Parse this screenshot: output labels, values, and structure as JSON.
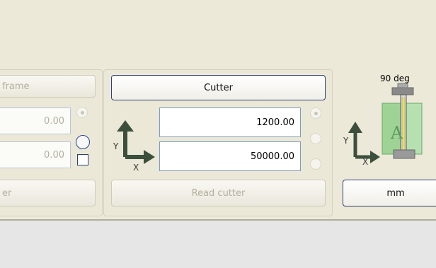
{
  "left_group": {
    "frame_label": "frame",
    "value1": "0.00",
    "value2": "0.00",
    "bottom_label": "er"
  },
  "cutter_group": {
    "cutter_button": "Cutter",
    "width_value": "1200.00",
    "height_value": "50000.00",
    "read_button": "Read cutter",
    "axis_y": "Y",
    "axis_x": "X"
  },
  "right_group": {
    "rotation_label": "90 deg",
    "glyph": "A",
    "unit_button": "mm",
    "axis_y": "Y",
    "axis_x": "X"
  }
}
